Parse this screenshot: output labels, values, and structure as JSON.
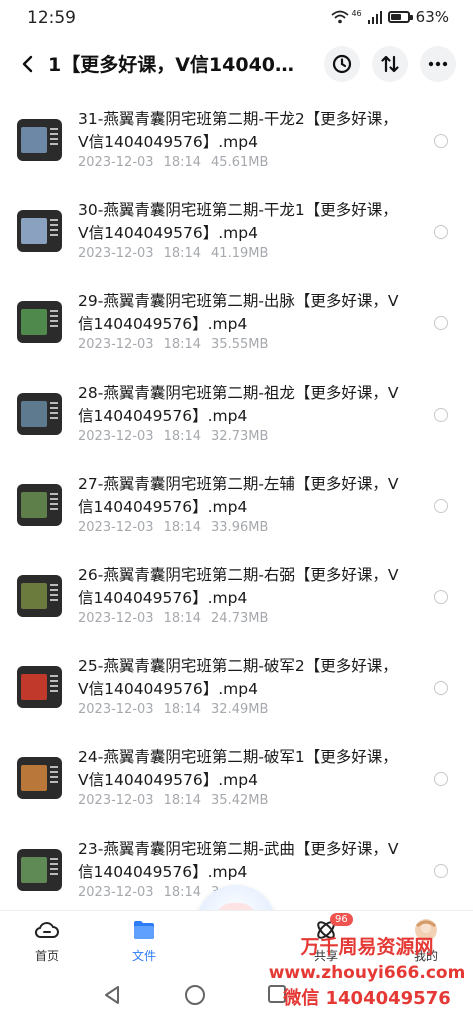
{
  "status": {
    "time": "12:59",
    "network": "46",
    "battery": "63%",
    "battery_level": 0.63
  },
  "header": {
    "title": "1【更多好课，V信1404049..."
  },
  "files": [
    {
      "name": "31-燕翼青囊阴宅班第二期-干龙2【更多好课，V信1404049576】.mp4",
      "date": "2023-12-03",
      "time": "18:14",
      "size": "45.61MB",
      "thumb_color": "#6d87a6"
    },
    {
      "name": "30-燕翼青囊阴宅班第二期-干龙1【更多好课，V信1404049576】.mp4",
      "date": "2023-12-03",
      "time": "18:14",
      "size": "41.19MB",
      "thumb_color": "#8aa2bf"
    },
    {
      "name": "29-燕翼青囊阴宅班第二期-出脉【更多好课，V信1404049576】.mp4",
      "date": "2023-12-03",
      "time": "18:14",
      "size": "35.55MB",
      "thumb_color": "#4f8a4c"
    },
    {
      "name": "28-燕翼青囊阴宅班第二期-祖龙【更多好课，V信1404049576】.mp4",
      "date": "2023-12-03",
      "time": "18:14",
      "size": "32.73MB",
      "thumb_color": "#5d7a8e"
    },
    {
      "name": "27-燕翼青囊阴宅班第二期-左辅【更多好课，V信1404049576】.mp4",
      "date": "2023-12-03",
      "time": "18:14",
      "size": "33.96MB",
      "thumb_color": "#5f7f4a"
    },
    {
      "name": "26-燕翼青囊阴宅班第二期-右弼【更多好课，V信1404049576】.mp4",
      "date": "2023-12-03",
      "time": "18:14",
      "size": "24.73MB",
      "thumb_color": "#6b7a3d"
    },
    {
      "name": "25-燕翼青囊阴宅班第二期-破军2【更多好课，V信1404049576】.mp4",
      "date": "2023-12-03",
      "time": "18:14",
      "size": "32.49MB",
      "thumb_color": "#c0392b"
    },
    {
      "name": "24-燕翼青囊阴宅班第二期-破军1【更多好课，V信1404049576】.mp4",
      "date": "2023-12-03",
      "time": "18:14",
      "size": "35.42MB",
      "thumb_color": "#b9773a"
    },
    {
      "name": "23-燕翼青囊阴宅班第二期-武曲【更多好课，V信1404049576】.mp4",
      "date": "2023-12-03",
      "time": "18:14",
      "size": "3",
      "thumb_color": "#5f8a55"
    }
  ],
  "tabs": [
    {
      "label": "首页",
      "icon": "cloud-icon"
    },
    {
      "label": "文件",
      "icon": "folder-icon"
    },
    {
      "label": "共享",
      "icon": "share-icon",
      "badge": "96"
    },
    {
      "label": "我的",
      "icon": "avatar"
    }
  ],
  "watermark": {
    "line1": "万千周易资源网",
    "line2": "www.zhouyi666.com",
    "line3": "微信 1404049576"
  },
  "colors": {
    "accent": "#2d7cf6",
    "watermark": "#e53935"
  }
}
